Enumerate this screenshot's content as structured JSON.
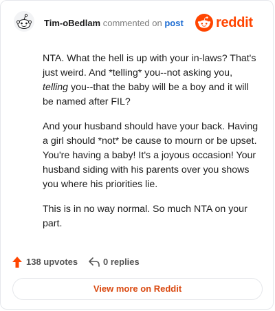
{
  "header": {
    "author": "Tim-oBedlam",
    "verb": "commented on",
    "post_link": "post",
    "brand": "reddit"
  },
  "comment": {
    "paragraphs": [
      {
        "parts": [
          "NTA. What the hell is up with your in-laws? That's just weird. And *telling* you--not asking you, ",
          "telling",
          " you--that the baby will be a boy and it will be named after FIL?"
        ]
      },
      {
        "text": "And your husband should have your back. Having a girl should *not* be cause to mourn or be upset. You're having a baby! It's a joyous occasion! Your husband siding with his parents over you shows you where his priorities lie."
      },
      {
        "text": "This is in no way normal. So much NTA on your part."
      }
    ]
  },
  "actions": {
    "upvotes": "138 upvotes",
    "replies": "0 replies",
    "upvote_icon": "upvote-arrow-icon",
    "reply_icon": "reply-arrow-icon"
  },
  "footer": {
    "button_label": "View more on Reddit"
  },
  "colors": {
    "brand": "#ff4500",
    "link": "#1a6ad1",
    "button_text": "#d9480f"
  }
}
